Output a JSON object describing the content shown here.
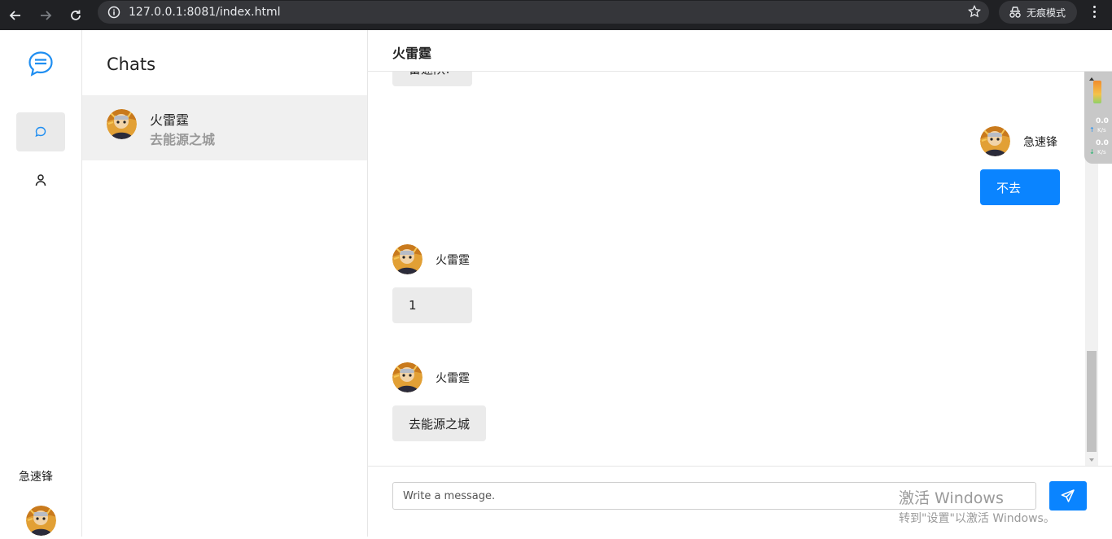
{
  "browser": {
    "url": "127.0.0.1:8081/index.html",
    "incognito_label": "无痕模式"
  },
  "rail": {
    "user_name": "急速锋"
  },
  "conversation_list": {
    "title": "Chats",
    "items": [
      {
        "name": "火雷霆",
        "last_message": "去能源之城"
      }
    ]
  },
  "chat": {
    "header_title": "火雷霆",
    "partial_top_message": "雷速队!",
    "messages": [
      {
        "author": "急速锋",
        "text": "不去",
        "side": "right"
      },
      {
        "author": "火雷霆",
        "text": "1",
        "side": "left"
      },
      {
        "author": "火雷霆",
        "text": "去能源之城",
        "side": "left"
      }
    ],
    "input_placeholder": "Write a message."
  },
  "watermark": {
    "line1": "激活 Windows",
    "line2": "转到\"设置\"以激活 Windows。"
  },
  "net_monitor": {
    "up_value": "0.0",
    "up_unit": "K/s",
    "down_value": "0.0",
    "down_unit": "K/s"
  },
  "colors": {
    "accent": "#0a84ff",
    "bubble_grey": "#ebebeb",
    "chrome_bg": "#202124"
  }
}
